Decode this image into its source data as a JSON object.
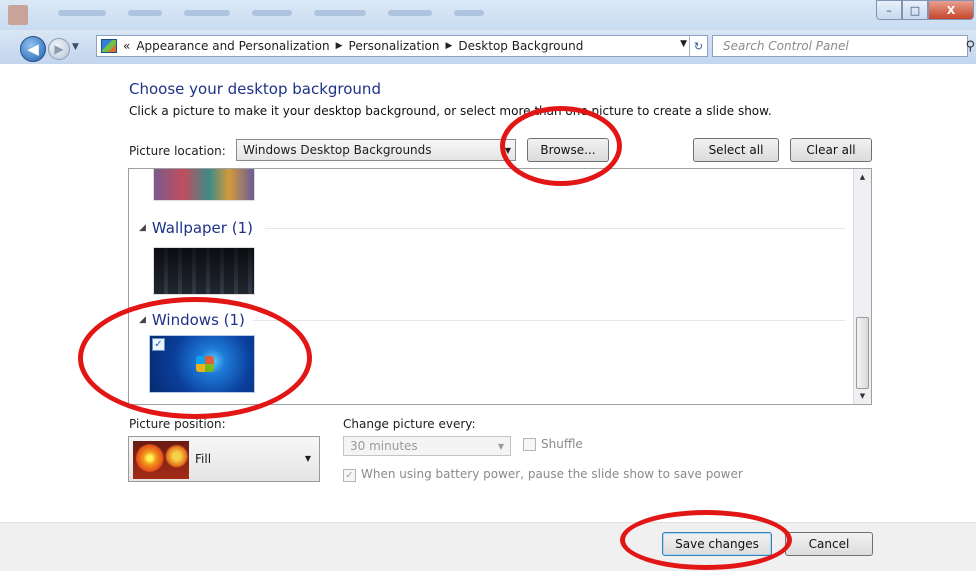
{
  "window": {
    "controls": {
      "minimize": "–",
      "maximize": "□",
      "close": "X"
    }
  },
  "nav": {
    "back_icon": "back-arrow-icon",
    "forward_icon": "forward-arrow-icon",
    "breadcrumbs": [
      "«",
      "Appearance and Personalization",
      "Personalization",
      "Desktop Background"
    ],
    "search_placeholder": "Search Control Panel"
  },
  "main": {
    "heading": "Choose your desktop background",
    "subtitle": "Click a picture to make it your desktop background, or select more than one picture to create a slide show.",
    "picture_location_label": "Picture location:",
    "picture_location_value": "Windows Desktop Backgrounds",
    "browse_label": "Browse...",
    "select_all_label": "Select all",
    "clear_all_label": "Clear all",
    "groups": [
      {
        "label": "Wallpaper (1)"
      },
      {
        "label": "Windows (1)",
        "selected": true
      }
    ],
    "picture_position_label": "Picture position:",
    "picture_position_value": "Fill",
    "change_picture_label": "Change picture every:",
    "change_picture_value": "30 minutes",
    "shuffle_label": "Shuffle",
    "battery_label": "When using battery power, pause the slide show to save power"
  },
  "footer": {
    "save_label": "Save changes",
    "cancel_label": "Cancel"
  },
  "colors": {
    "heading": "#1e3287",
    "annotation_circles": "#e31616"
  }
}
